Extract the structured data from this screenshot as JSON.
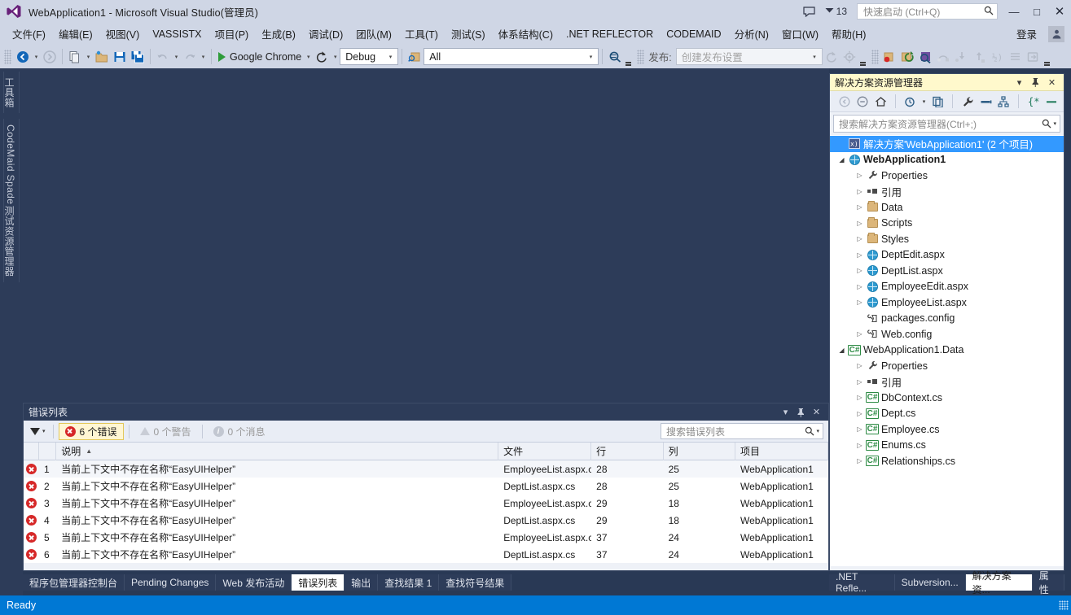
{
  "titlebar": {
    "title": "WebApplication1 - Microsoft Visual Studio(管理员)",
    "logo_icon": "visual-studio-logo",
    "feedback_icon": "feedback-icon",
    "notification_icon": "notification-flag-icon",
    "notification_count": "13",
    "quick_launch_placeholder": "快速启动 (Ctrl+Q)",
    "quick_launch_value": "",
    "search_icon": "search-icon",
    "minimize_label": "—",
    "maximize_label": "□",
    "close_label": "✕"
  },
  "menubar": {
    "items": [
      {
        "label": "文件(F)"
      },
      {
        "label": "编辑(E)"
      },
      {
        "label": "视图(V)"
      },
      {
        "label": "VASSISTX"
      },
      {
        "label": "项目(P)"
      },
      {
        "label": "生成(B)"
      },
      {
        "label": "调试(D)"
      },
      {
        "label": "团队(M)"
      },
      {
        "label": "工具(T)"
      },
      {
        "label": "测试(S)"
      },
      {
        "label": "体系结构(C)"
      },
      {
        "label": ".NET REFLECTOR"
      },
      {
        "label": "CODEMAID"
      },
      {
        "label": "分析(N)"
      },
      {
        "label": "窗口(W)"
      },
      {
        "label": "帮助(H)"
      }
    ],
    "signin_label": "登录",
    "account_icon": "account-icon"
  },
  "toolbar": {
    "nav_back_icon": "navigate-back-icon",
    "nav_forward_icon": "navigate-forward-icon",
    "new_project_icon": "new-project-icon",
    "open_file_icon": "open-file-icon",
    "save_icon": "save-icon",
    "save_all_icon": "save-all-icon",
    "undo_icon": "undo-icon",
    "redo_icon": "redo-icon",
    "start_icon": "play-icon",
    "start_label": "Google Chrome",
    "refresh_icon": "refresh-icon",
    "config_value": "Debug",
    "find_icon": "find-in-files-icon",
    "scope_value": "All",
    "search_icon": "quick-find-icon",
    "publish_label": "发布:",
    "publish_placeholder": "创建发布设置",
    "publish_refresh_icon": "publish-refresh-icon",
    "publish_settings_icon": "gear-icon",
    "debug_icons": [
      "breakpoint-icon",
      "restart-icon",
      "find-symbol-icon",
      "step-over-icon",
      "step-into-icon",
      "step-out-icon",
      "hex-icon",
      "toggle-icon"
    ],
    "overflow_label": "▾"
  },
  "left_tabs": [
    {
      "label": "工具箱",
      "name": "toolbox"
    },
    {
      "label": "CodeMaid Spade",
      "name": "codemaid-spade"
    },
    {
      "label": "测试资源管理器",
      "name": "test-explorer"
    }
  ],
  "error_list": {
    "title": "错误列表",
    "dropdown_icon": "chevron-down-icon",
    "pin_icon": "pin-icon",
    "close_icon": "close-icon",
    "filter_icon": "filter-funnel-icon",
    "filter_caret": "▾",
    "errors_label": "6 个错误",
    "warnings_label": "0 个警告",
    "messages_label": "0 个消息",
    "search_placeholder": "搜索错误列表",
    "search_icon": "search-icon",
    "search_caret": "▾",
    "sort_caret": "▲",
    "columns": [
      "",
      "",
      "说明",
      "文件",
      "行",
      "列",
      "项目"
    ],
    "rows": [
      {
        "severity_icon": "error-icon",
        "num": "1",
        "desc": "当前上下文中不存在名称“EasyUIHelper”",
        "file": "EmployeeList.aspx.c",
        "line": "28",
        "col": "25",
        "project": "WebApplication1"
      },
      {
        "severity_icon": "error-icon",
        "num": "2",
        "desc": "当前上下文中不存在名称“EasyUIHelper”",
        "file": "DeptList.aspx.cs",
        "line": "28",
        "col": "25",
        "project": "WebApplication1"
      },
      {
        "severity_icon": "error-icon",
        "num": "3",
        "desc": "当前上下文中不存在名称“EasyUIHelper”",
        "file": "EmployeeList.aspx.c",
        "line": "29",
        "col": "18",
        "project": "WebApplication1"
      },
      {
        "severity_icon": "error-icon",
        "num": "4",
        "desc": "当前上下文中不存在名称“EasyUIHelper”",
        "file": "DeptList.aspx.cs",
        "line": "29",
        "col": "18",
        "project": "WebApplication1"
      },
      {
        "severity_icon": "error-icon",
        "num": "5",
        "desc": "当前上下文中不存在名称“EasyUIHelper”",
        "file": "EmployeeList.aspx.c",
        "line": "37",
        "col": "24",
        "project": "WebApplication1"
      },
      {
        "severity_icon": "error-icon",
        "num": "6",
        "desc": "当前上下文中不存在名称“EasyUIHelper”",
        "file": "DeptList.aspx.cs",
        "line": "37",
        "col": "24",
        "project": "WebApplication1"
      }
    ]
  },
  "solution_explorer": {
    "title": "解决方案资源管理器",
    "dropdown_icon": "chevron-down-icon",
    "pin_icon": "pin-icon",
    "close_icon": "close-icon",
    "toolbar_icons": [
      "back-icon",
      "forward-icon",
      "home-icon",
      "pending-changes-icon",
      "sync-with-active-doc-icon",
      "properties-wrench-icon",
      "show-all-files-icon",
      "view-class-diagram-icon",
      "preview-selected-items-icon",
      "collapse-all-icon"
    ],
    "search_placeholder": "搜索解决方案资源管理器(Ctrl+;)",
    "search_icon": "search-icon",
    "search_caret": "▾",
    "tree": [
      {
        "label": "解决方案'WebApplication1' (2 个项目)",
        "indent": 0,
        "twisty": "",
        "icon": "solution-icon",
        "selected": true,
        "bold": false
      },
      {
        "label": "WebApplication1",
        "indent": 1,
        "twisty": "open",
        "icon": "web-project-icon",
        "selected": false,
        "bold": true
      },
      {
        "label": "Properties",
        "indent": 2,
        "twisty": "closed",
        "icon": "wrench-icon",
        "selected": false,
        "bold": false
      },
      {
        "label": "引用",
        "indent": 2,
        "twisty": "closed",
        "icon": "references-icon",
        "selected": false,
        "bold": false
      },
      {
        "label": "Data",
        "indent": 2,
        "twisty": "closed",
        "icon": "folder-icon",
        "selected": false,
        "bold": false
      },
      {
        "label": "Scripts",
        "indent": 2,
        "twisty": "closed",
        "icon": "folder-icon",
        "selected": false,
        "bold": false
      },
      {
        "label": "Styles",
        "indent": 2,
        "twisty": "closed",
        "icon": "folder-icon",
        "selected": false,
        "bold": false
      },
      {
        "label": "DeptEdit.aspx",
        "indent": 2,
        "twisty": "closed",
        "icon": "aspx-page-icon",
        "selected": false,
        "bold": false
      },
      {
        "label": "DeptList.aspx",
        "indent": 2,
        "twisty": "closed",
        "icon": "aspx-page-icon",
        "selected": false,
        "bold": false
      },
      {
        "label": "EmployeeEdit.aspx",
        "indent": 2,
        "twisty": "closed",
        "icon": "aspx-page-icon",
        "selected": false,
        "bold": false
      },
      {
        "label": "EmployeeList.aspx",
        "indent": 2,
        "twisty": "closed",
        "icon": "aspx-page-icon",
        "selected": false,
        "bold": false
      },
      {
        "label": "packages.config",
        "indent": 2,
        "twisty": "",
        "icon": "config-file-icon",
        "selected": false,
        "bold": false
      },
      {
        "label": "Web.config",
        "indent": 2,
        "twisty": "closed",
        "icon": "config-file-icon",
        "selected": false,
        "bold": false
      },
      {
        "label": "WebApplication1.Data",
        "indent": 1,
        "twisty": "open",
        "icon": "csharp-project-icon",
        "selected": false,
        "bold": false
      },
      {
        "label": "Properties",
        "indent": 2,
        "twisty": "closed",
        "icon": "wrench-icon",
        "selected": false,
        "bold": false
      },
      {
        "label": "引用",
        "indent": 2,
        "twisty": "closed",
        "icon": "references-icon",
        "selected": false,
        "bold": false
      },
      {
        "label": "DbContext.cs",
        "indent": 2,
        "twisty": "closed",
        "icon": "csharp-file-icon",
        "selected": false,
        "bold": false
      },
      {
        "label": "Dept.cs",
        "indent": 2,
        "twisty": "closed",
        "icon": "csharp-file-icon",
        "selected": false,
        "bold": false
      },
      {
        "label": "Employee.cs",
        "indent": 2,
        "twisty": "closed",
        "icon": "csharp-file-icon",
        "selected": false,
        "bold": false
      },
      {
        "label": "Enums.cs",
        "indent": 2,
        "twisty": "closed",
        "icon": "csharp-file-icon",
        "selected": false,
        "bold": false
      },
      {
        "label": "Relationships.cs",
        "indent": 2,
        "twisty": "closed",
        "icon": "csharp-file-icon",
        "selected": false,
        "bold": false
      }
    ]
  },
  "bottom_tabs_left": [
    {
      "label": "程序包管理器控制台",
      "active": false
    },
    {
      "label": "Pending Changes",
      "active": false
    },
    {
      "label": "Web 发布活动",
      "active": false
    },
    {
      "label": "错误列表",
      "active": true
    },
    {
      "label": "输出",
      "active": false
    },
    {
      "label": "查找结果 1",
      "active": false
    },
    {
      "label": "查找符号结果",
      "active": false
    }
  ],
  "bottom_tabs_right": [
    {
      "label": ".NET Refle...",
      "active": false
    },
    {
      "label": "Subversion...",
      "active": false
    },
    {
      "label": "解决方案资...",
      "active": true
    },
    {
      "label": "属性",
      "active": false
    }
  ],
  "statusbar": {
    "text": "Ready",
    "accent_color": "#0078d4",
    "resize_grip_icon": "resize-grip-icon"
  }
}
